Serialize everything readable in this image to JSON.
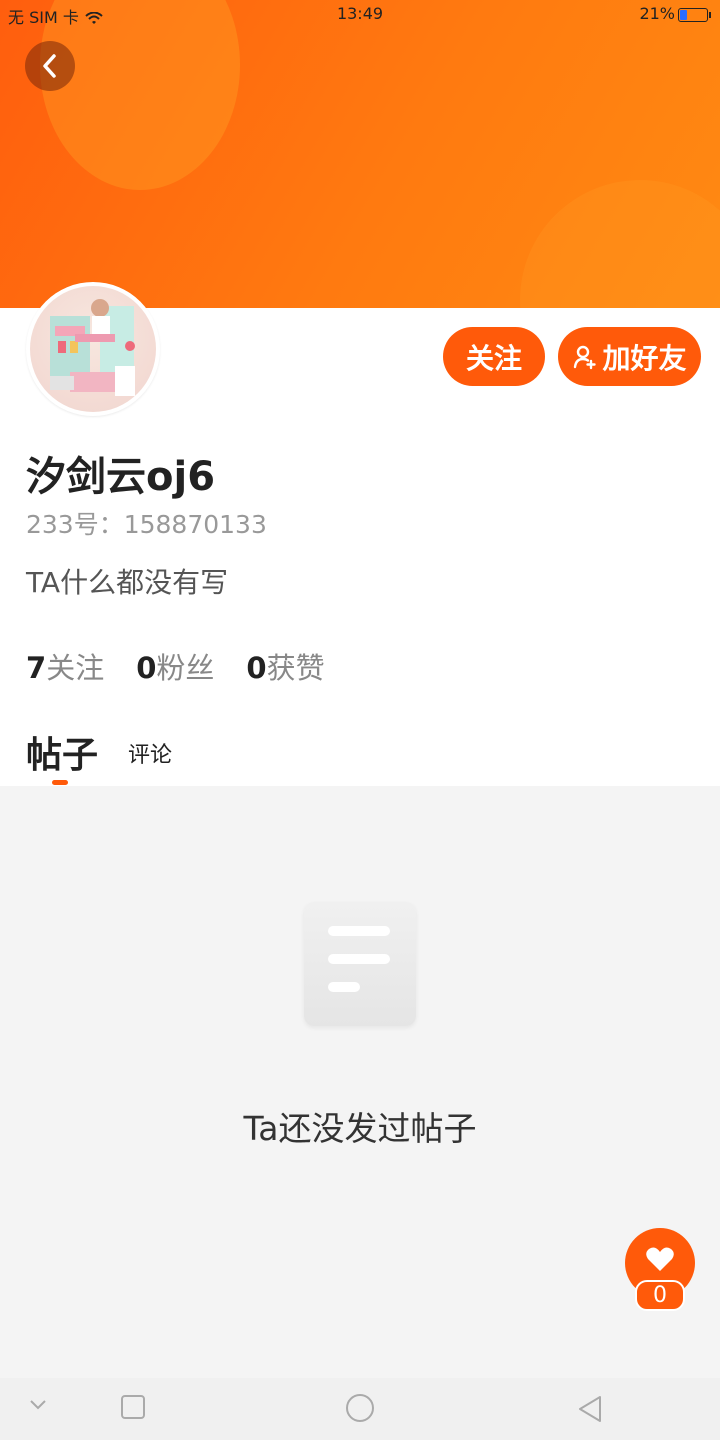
{
  "status_bar": {
    "carrier": "无 SIM 卡",
    "time": "13:49",
    "battery": "21%"
  },
  "header": {
    "back_icon": "chevron-left-icon"
  },
  "profile": {
    "username": "汐剑云oj6",
    "id_label": "233号：158870133",
    "bio": "TA什么都没有写",
    "follow_label": "关注",
    "add_friend_label": "加好友",
    "stats": [
      {
        "value": "7",
        "label": "关注"
      },
      {
        "value": "0",
        "label": "粉丝"
      },
      {
        "value": "0",
        "label": "获赞"
      }
    ]
  },
  "tabs": {
    "posts": "帖子",
    "comments": "评论"
  },
  "empty_state": {
    "message": "Ta还没发过帖子",
    "icon": "document-icon"
  },
  "like_fab": {
    "count": "0",
    "icon": "heart-icon"
  },
  "nav_bar": [
    "chevron-down-icon",
    "square-icon",
    "circle-icon",
    "triangle-back-icon"
  ],
  "colors": {
    "accent": "#ff5a0a",
    "banner": "#ff7a10"
  }
}
